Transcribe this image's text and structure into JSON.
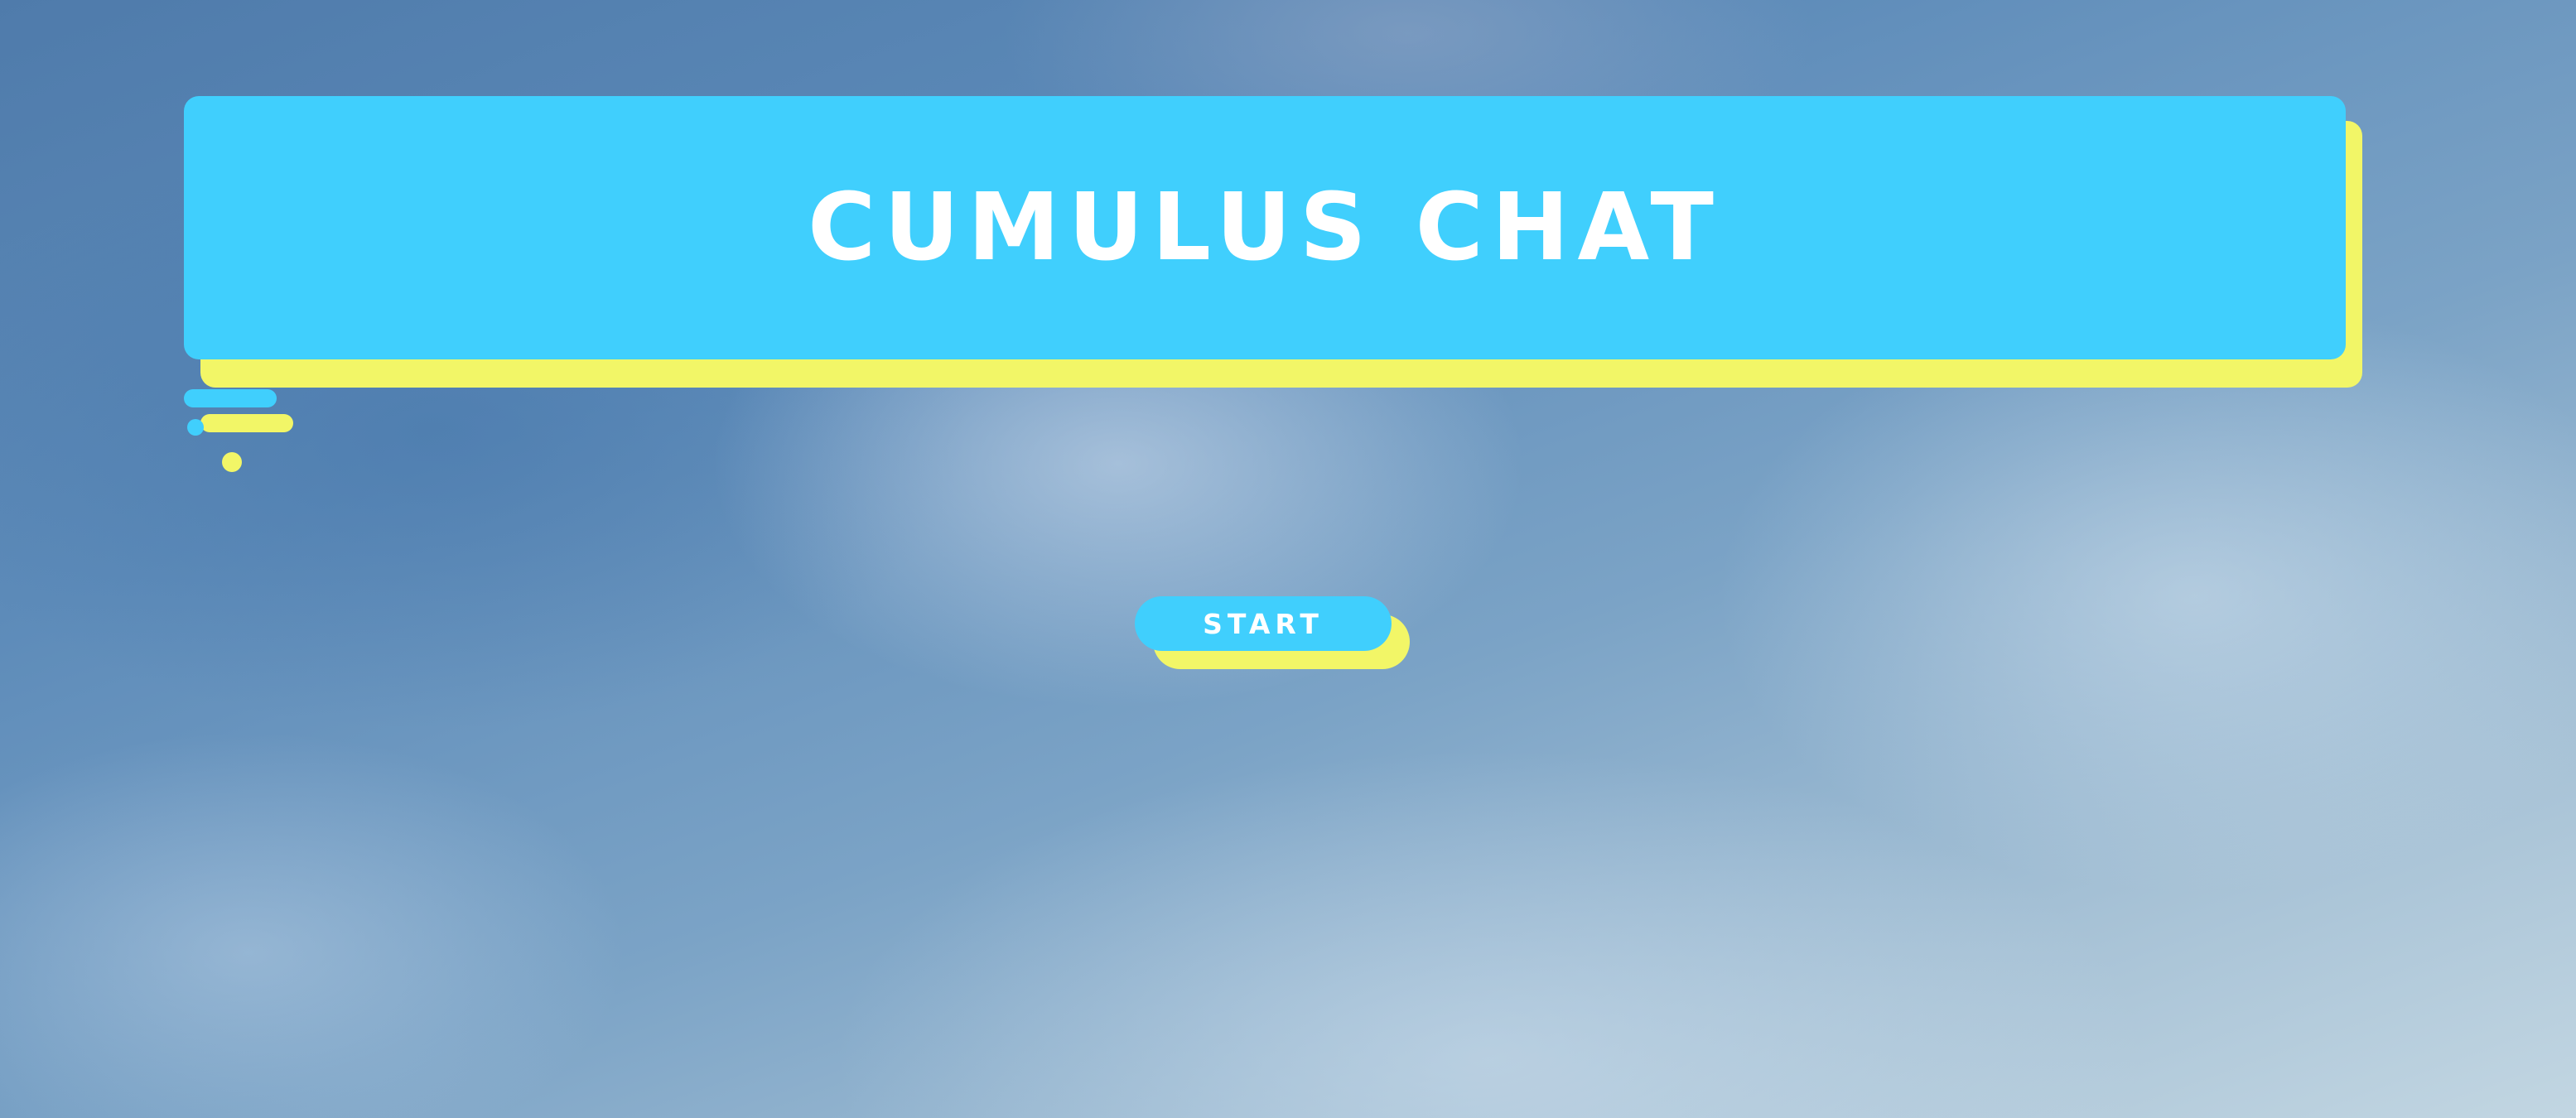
{
  "app": {
    "title": "CUMULUS CHAT"
  },
  "start": {
    "label": "START"
  },
  "colors": {
    "primary": "#40cffd",
    "accent": "#f2f667",
    "text": "#ffffff",
    "sky": "#5d8bb9"
  }
}
